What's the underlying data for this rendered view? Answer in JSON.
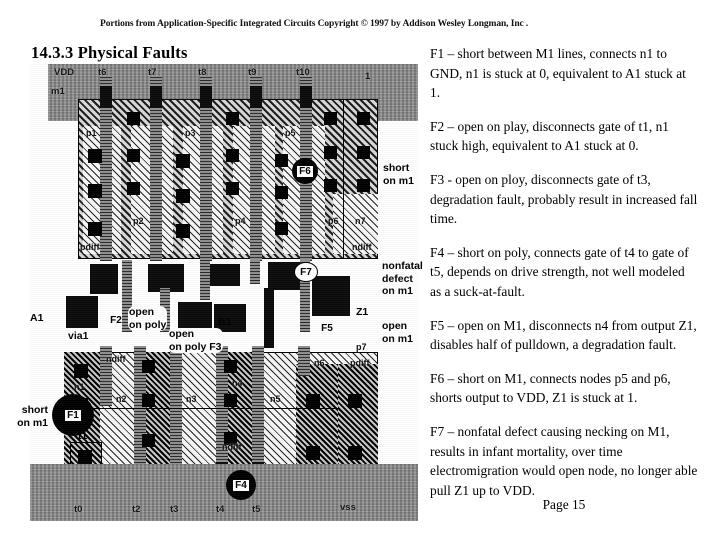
{
  "header": {
    "credit": "Portions from Application-Specific Integrated Circuits Copyright © 1997 by Addison Wesley Longman, Inc ."
  },
  "heading": {
    "title": "14.3.3 Physical Faults"
  },
  "faults": [
    {
      "id": "F1",
      "text": "F1 – short between M1 lines, connects n1 to GND, n1 is stuck at 0, equivalent to A1 stuck at 1."
    },
    {
      "id": "F2",
      "text": "F2 – open on play, disconnects gate of t1, n1 stuck high, equivalent to A1 stuck at 0."
    },
    {
      "id": "F3",
      "text": "F3 -  open on ploy, disconnects gate of t3, degradation fault, probably result in increased fall time."
    },
    {
      "id": "F4",
      "text": "F4 – short on poly, connects gate of t4 to gate of t5, depends on drive strength, not well modeled as a suck-at-fault."
    },
    {
      "id": "F5",
      "text": "F5 – open on M1, disconnects n4 from output Z1, disables half of pulldown, a degradation fault."
    },
    {
      "id": "F6",
      "text": "F6 – short on M1, connects nodes p5 and p6, shorts output to VDD, Z1 is stuck at 1."
    },
    {
      "id": "F7",
      "text": "F7 – nonfatal defect causing necking on M1, results in infant mortality, over time electromigration would open node, no longer able pull Z1 up to VDD."
    }
  ],
  "footer": {
    "page": "Page 15"
  },
  "layout": {
    "rails": {
      "vdd_label": "VDD",
      "vdd_metal_label": "m1",
      "vss_label": "vss"
    },
    "top_gates": [
      {
        "label": "t6"
      },
      {
        "label": "t7"
      },
      {
        "label": "t8"
      },
      {
        "label": "t9"
      },
      {
        "label": "t10"
      },
      {
        "label": "1"
      }
    ],
    "bottom_gates": [
      {
        "label": "t0"
      },
      {
        "label": "t2"
      },
      {
        "label": "t3"
      },
      {
        "label": "t4"
      },
      {
        "label": "t5"
      }
    ],
    "p_nodes": [
      {
        "label": "p1"
      },
      {
        "label": "p2"
      },
      {
        "label": "p3"
      },
      {
        "label": "p4"
      },
      {
        "label": "p5"
      },
      {
        "label": "p6"
      },
      {
        "label": "n7"
      },
      {
        "label": "p7"
      }
    ],
    "n_nodes": [
      {
        "label": "n1"
      },
      {
        "label": "n2"
      },
      {
        "label": "n3"
      },
      {
        "label": "n4"
      },
      {
        "label": "n5"
      },
      {
        "label": "n6"
      }
    ],
    "diffusion_labels": [
      {
        "label": "pdiff"
      },
      {
        "label": "ndiff"
      },
      {
        "label": "ndiff"
      },
      {
        "label": "ndiff"
      },
      {
        "label": "pdiff"
      }
    ],
    "pin_labels": [
      {
        "label": "A1"
      },
      {
        "label": "B1"
      },
      {
        "label": "Z1"
      },
      {
        "label": "via1"
      },
      {
        "label": "t1"
      }
    ],
    "markers": [
      {
        "id": "F1",
        "note": "short\non m1"
      },
      {
        "id": "F2",
        "note": "open\non poly"
      },
      {
        "id": "F3",
        "note": "open\non poly F3"
      },
      {
        "id": "F4",
        "note": ""
      },
      {
        "id": "F5",
        "note": "open\non m1"
      },
      {
        "id": "F6",
        "note": "short\non m1"
      },
      {
        "id": "F7",
        "note": "nonfatal\ndefect\non m1"
      }
    ]
  }
}
